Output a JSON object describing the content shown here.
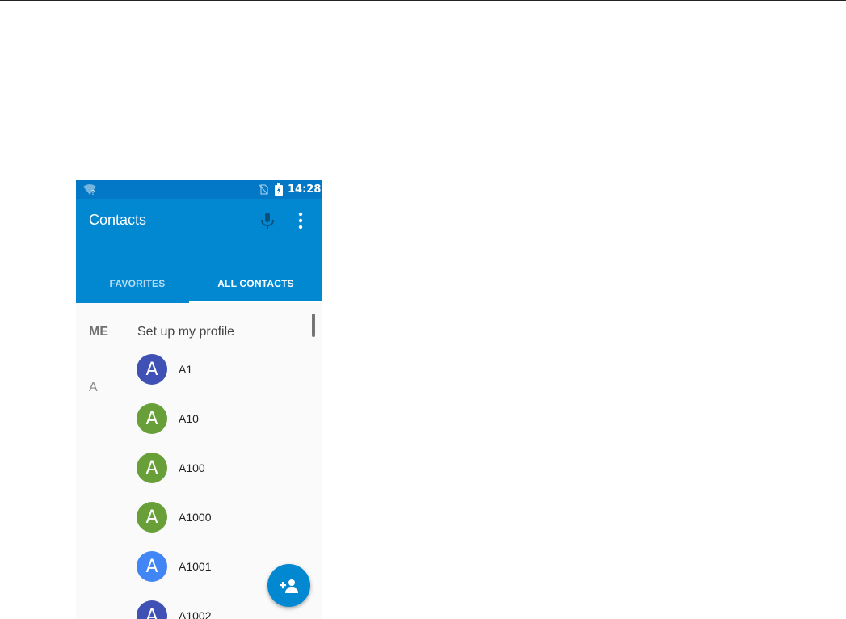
{
  "status_bar": {
    "time": "14:28"
  },
  "toolbar": {
    "title": "Contacts"
  },
  "tabs": [
    {
      "label": "FAVORITES",
      "selected": false
    },
    {
      "label": "ALL CONTACTS",
      "selected": true
    }
  ],
  "profile": {
    "section": "ME",
    "text": "Set up my profile"
  },
  "contacts_section": "A",
  "contacts": [
    {
      "initial": "A",
      "name": "A1",
      "color": "#3f51b5"
    },
    {
      "initial": "A",
      "name": "A10",
      "color": "#689f38"
    },
    {
      "initial": "A",
      "name": "A100",
      "color": "#689f38"
    },
    {
      "initial": "A",
      "name": "A1000",
      "color": "#689f38"
    },
    {
      "initial": "A",
      "name": "A1001",
      "color": "#4285f4"
    },
    {
      "initial": "A",
      "name": "A1002",
      "color": "#3f51b5"
    }
  ],
  "colors": {
    "primary": "#0288d1",
    "status_bar": "#0278c6",
    "list_background": "#fafafa"
  },
  "icons": {
    "status": [
      "wifi-question-icon",
      "no-sim-icon",
      "battery-charging-icon"
    ],
    "toolbar": [
      "mic-icon",
      "more-vert-icon"
    ],
    "fab": "person-add-icon"
  }
}
